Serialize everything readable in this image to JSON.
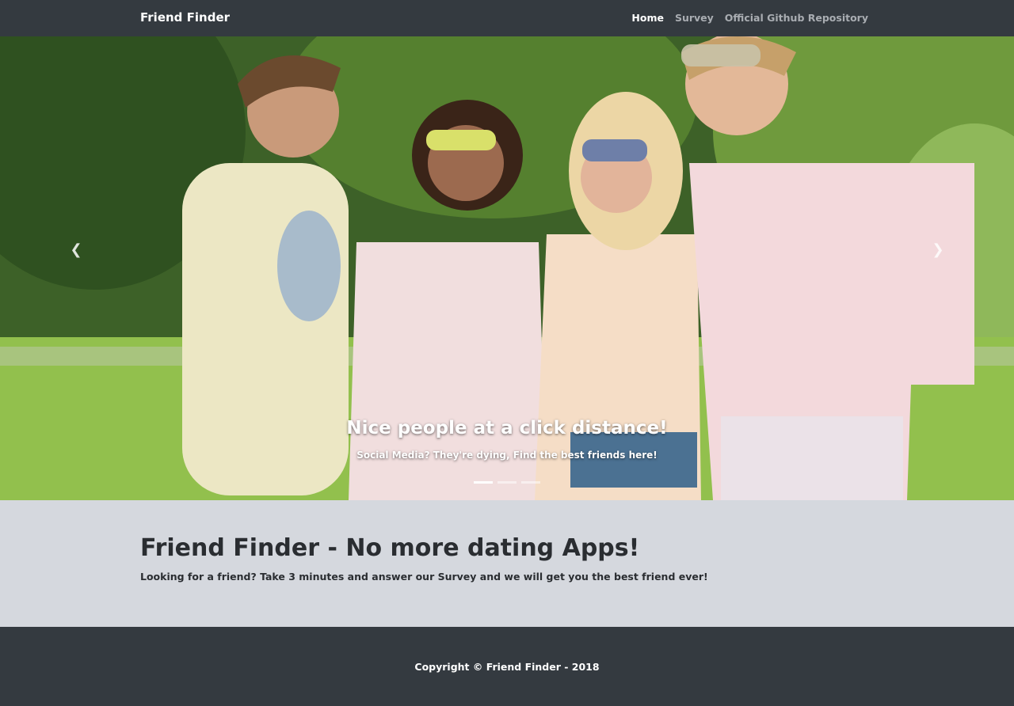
{
  "navbar": {
    "brand": "Friend Finder",
    "links": [
      {
        "label": "Home",
        "active": true
      },
      {
        "label": "Survey",
        "active": false
      },
      {
        "label": "Official Github Repository",
        "active": false
      }
    ]
  },
  "carousel": {
    "caption_title": "Nice people at a click distance!",
    "caption_text": "Social Media? They're dying, Find the best friends here!",
    "prev_icon": "chevron-left-icon",
    "next_icon": "chevron-right-icon",
    "indicator_count": 3,
    "active_indicator": 0
  },
  "jumbotron": {
    "title": "Friend Finder - No more dating Apps!",
    "lead": "Looking for a friend? Take 3 minutes and answer our Survey and we will get you the best friend ever!"
  },
  "footer": {
    "copyright": "Copyright © Friend Finder - 2018"
  },
  "colors": {
    "navbar_bg": "#343a40",
    "jumbotron_bg": "#d5d8de",
    "footer_bg": "#343a40"
  }
}
